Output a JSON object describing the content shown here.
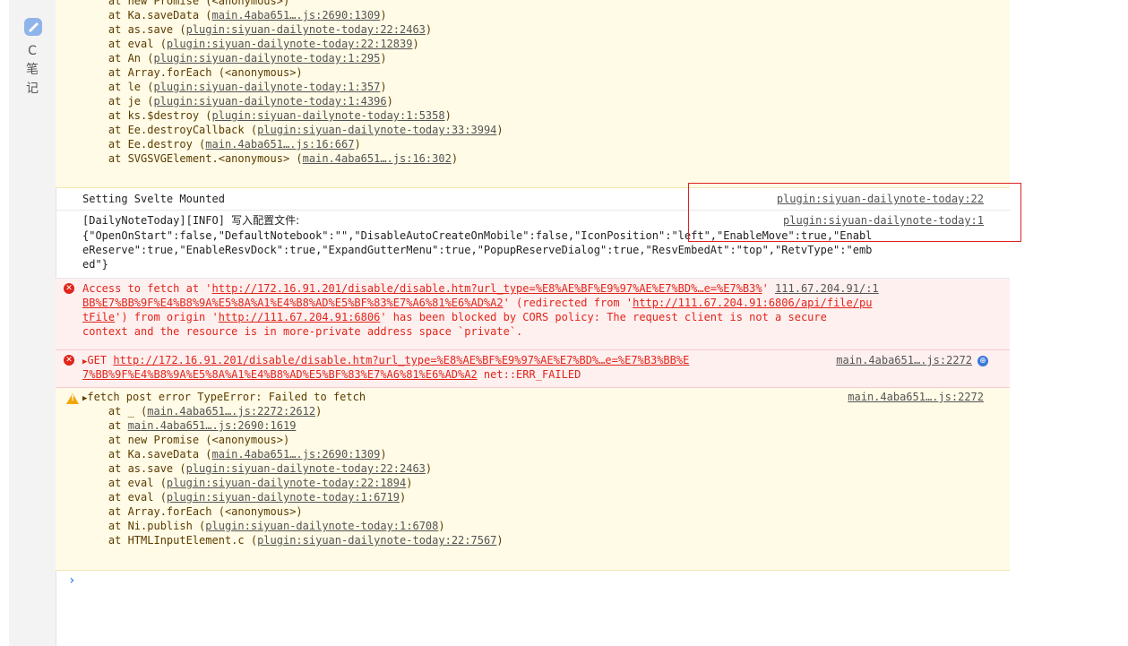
{
  "sidebar": {
    "labels": [
      "C",
      "笔",
      "记"
    ]
  },
  "block1": {
    "lines": [
      "    at new Promise (<anonymous>)",
      "    at Ka.saveData (",
      "    at as.save (",
      "    at eval (",
      "    at An (",
      "    at Array.forEach (<anonymous>)",
      "    at le (",
      "    at je (",
      "    at ks.$destroy (",
      "    at Ee.destroyCallback (",
      "    at Ee.destroy (",
      "    at SVGSVGElement.<anonymous> ("
    ],
    "links": [
      "",
      "main.4aba651….js:2690:1309",
      "plugin:siyuan-dailynote-today:22:2463",
      "plugin:siyuan-dailynote-today:22:12839",
      "plugin:siyuan-dailynote-today:1:295",
      "",
      "plugin:siyuan-dailynote-today:1:357",
      "plugin:siyuan-dailynote-today:1:4396",
      "plugin:siyuan-dailynote-today:1:5358",
      "plugin:siyuan-dailynote-today:33:3994",
      "main.4aba651….js:16:667",
      "main.4aba651….js:16:302"
    ]
  },
  "msg_mounted": {
    "text": "Setting Svelte Mounted",
    "source": "plugin:siyuan-dailynote-today:22"
  },
  "msg_config": {
    "prefix": "[DailyNoteToday][INFO] ",
    "chinese": "写入配置文件:",
    "source": "plugin:siyuan-dailynote-today:1",
    "lines": [
      "{\"OpenOnStart\":false,\"DefaultNotebook\":\"\",\"DisableAutoCreateOnMobile\":false,\"IconPosition\":\"left\",\"EnableMove\":true,\"Enabl",
      "eReserve\":true,\"EnableResvDock\":true,\"ExpandGutterMenu\":true,\"PopupReserveDialog\":true,\"ResvEmbedAt\":\"top\",\"RetvType\":\"emb",
      "ed\"}"
    ]
  },
  "err_cors": {
    "l1_a": "Access to fetch at '",
    "l1_link": "http://172.16.91.201/disable/disable.htm?url_type=%E8%AE%BF%E9%97%AE%E7%BD%…e=%E7%B3%",
    "l1_link2": "111.67.204.91/:1",
    "l2_link": "BB%E7%BB%9F%E4%B8%9A%E5%8A%A1%E4%B8%AD%E5%BF%83%E7%A6%81%E6%AD%A2",
    "l2_b": "' (redirected from '",
    "l2_link2": "http://111.67.204.91:6806/api/file/pu",
    "l3_link": "tFile",
    "l3_b": "') from origin '",
    "l3_link2": "http://111.67.204.91:6806",
    "l3_c": "' has been blocked by CORS policy: The request client is not a secure",
    "l4": "context and the resource is in more-private address space `private`."
  },
  "err_get": {
    "method": "GET",
    "url1": "http://172.16.91.201/disable/disable.htm?url_type=%E8%AE%BF%E9%97%AE%E7%BD%…e=%E7%B3%BB%E",
    "source": "main.4aba651….js:2272",
    "url2": "7%BB%9F%E4%B8%9A%E5%8A%A1%E4%B8%AD%E5%BF%83%E7%A6%81%E6%AD%A2",
    "status": " net::ERR_FAILED"
  },
  "warn_fetch": {
    "title": "fetch post error TypeError: Failed to fetch",
    "source": "main.4aba651….js:2272",
    "lines": [
      "    at _ (",
      "    at ",
      "    at new Promise (<anonymous>)",
      "    at Ka.saveData (",
      "    at as.save (",
      "    at eval (",
      "    at eval (",
      "    at Array.forEach (<anonymous>)",
      "    at Ni.publish (",
      "    at HTMLInputElement.c ("
    ],
    "links": [
      "main.4aba651….js:2272:2612",
      "main.4aba651….js:2690:1619",
      "",
      "main.4aba651….js:2690:1309",
      "plugin:siyuan-dailynote-today:22:2463",
      "plugin:siyuan-dailynote-today:22:1894",
      "plugin:siyuan-dailynote-today:1:6719",
      "",
      "plugin:siyuan-dailynote-today:1:6708",
      "plugin:siyuan-dailynote-today:22:7567"
    ]
  },
  "prompt": "›"
}
